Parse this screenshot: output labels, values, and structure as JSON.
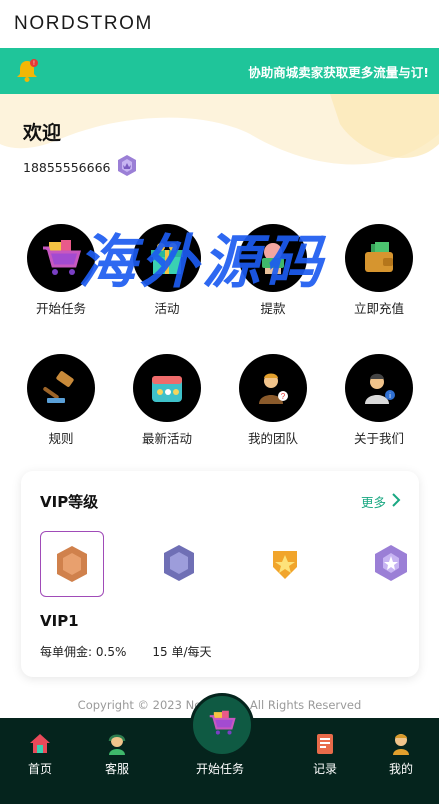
{
  "header": {
    "brand": "NORDSTROM"
  },
  "banner": {
    "icon": "bell-icon",
    "text": "协助商城卖家获取更多流量与订!"
  },
  "user": {
    "welcome": "欢迎",
    "phone": "18855556666",
    "level_icon": "vip-badge-icon"
  },
  "watermark": "海外源码",
  "grid_row1": [
    {
      "label": "开始任务",
      "icon": "shopping-cart-icon"
    },
    {
      "label": "活动",
      "icon": "gift-icon"
    },
    {
      "label": "提款",
      "icon": "money-hand-icon"
    },
    {
      "label": "立即充值",
      "icon": "wallet-icon"
    }
  ],
  "grid_row2": [
    {
      "label": "规则",
      "icon": "gavel-icon"
    },
    {
      "label": "最新活动",
      "icon": "calendar-icon"
    },
    {
      "label": "我的团队",
      "icon": "team-icon"
    },
    {
      "label": "关于我们",
      "icon": "about-icon"
    }
  ],
  "vip": {
    "title": "VIP等级",
    "more": "更多",
    "badges": [
      "vip1-badge-icon",
      "vip2-badge-icon",
      "vip3-badge-icon",
      "vip4-badge-icon"
    ],
    "level": "VIP1",
    "commission_label": "每单佣金:",
    "commission_value": "0.5%",
    "orders_value": "15",
    "orders_unit": "单/每天"
  },
  "footer": {
    "copyright": "Copyright © 2023 Nordstrom All Rights Reserved"
  },
  "tabbar": {
    "home": "首页",
    "service": "客服",
    "start": "开始任务",
    "records": "记录",
    "mine": "我的"
  },
  "colors": {
    "accent": "#1fc59a",
    "tabbar": "#05241d",
    "watermark": "#1d5cf0"
  }
}
